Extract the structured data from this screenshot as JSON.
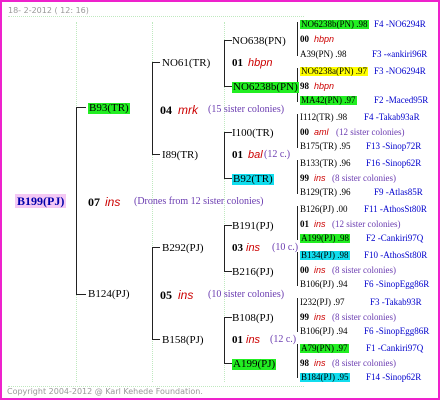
{
  "header": {
    "date": "18-  2-2012 ( 12: 16)"
  },
  "footer": {
    "copyright": "Copyright 2004-2012 @ Karl Kehede Foundation."
  },
  "colors": {
    "frame": "#ee22cc",
    "green": "#22ee22",
    "yellow": "#ffff00",
    "cyan": "#11ddee",
    "root_bg": "#f4c8f4",
    "code_red": "#cc0000",
    "paren_purple": "#6a3bb0",
    "blue_text": "#0000cc"
  },
  "gen1": {
    "name": "B199(PJ)",
    "year": "07",
    "code": "ins",
    "note": "(Drones from 12 sister colonies)"
  },
  "gen2": [
    {
      "name": "B93(TR)",
      "year": "04",
      "code": "mrk",
      "note": "(15 sister colonies)"
    },
    {
      "name": "B124(PJ)",
      "year": "05",
      "code": "ins",
      "note": "(10 sister colonies)"
    }
  ],
  "gen3": [
    {
      "name": "NO61(TR)",
      "year": "01",
      "code": "hbpn"
    },
    {
      "name": "I89(TR)",
      "year": "01",
      "code": "bal",
      "note": "(12 c.)"
    },
    {
      "name": "B292(PJ)",
      "year": "03",
      "code": "ins",
      "note": "(10 c.)"
    },
    {
      "name": "B158(PJ)",
      "year": "01",
      "code": "ins",
      "note": "(12 c.)"
    }
  ],
  "gen4": [
    {
      "name": "NO638(PN)",
      "year": "00",
      "code": "hbpn"
    },
    {
      "name": "NO6238b(PN)",
      "year": "",
      "code": ""
    },
    {
      "name": "I100(TR)",
      "year": "01",
      "code": "bal",
      "note": "(12 c.)"
    },
    {
      "name": "B92(TR)",
      "year": "",
      "code": ""
    },
    {
      "name": "B191(PJ)",
      "year": "",
      "code": ""
    },
    {
      "name": "B216(PJ)",
      "year": "",
      "code": ""
    },
    {
      "name": "B108(PJ)",
      "year": "",
      "code": ""
    },
    {
      "name": "A199(PJ)",
      "year": "",
      "code": ""
    }
  ],
  "gen5": [
    {
      "name": "NO6238b(PN) .98",
      "year": "00",
      "code": "hbpn",
      "tail": "F4 -NO6294R"
    },
    {
      "name": "A39(PN) .98",
      "year": "",
      "code": "",
      "tail": "F3 -«ankiri96R"
    },
    {
      "name": "NO6238a(PN) .97",
      "year": "98",
      "code": "hbpn",
      "tail": "F3 -NO6294R"
    },
    {
      "name": "MA42(PN) .97",
      "year": "",
      "code": "",
      "tail": "F2 -Maced95R"
    },
    {
      "name": "I112(TR) .98",
      "year": "00",
      "code": "aml",
      "note": "(12 sister colonies)",
      "tail": "F4 -Takab93aR"
    },
    {
      "name": "B175(TR) .95",
      "year": "",
      "code": "",
      "tail": "F13 -Sinop72R"
    },
    {
      "name": "B133(TR) .96",
      "year": "99",
      "code": "ins",
      "note": "(8 sister colonies)",
      "tail": "F16 -Sinop62R"
    },
    {
      "name": "B129(TR) .96",
      "year": "",
      "code": "",
      "tail": "F9 -Atlas85R"
    },
    {
      "name": "B126(PJ) .00",
      "year": "01",
      "code": "ins",
      "note": "(12 sister colonies)",
      "tail": "F11 -AthosSt80R"
    },
    {
      "name": "A199(PJ) .98",
      "year": "",
      "code": "",
      "tail": "F2 -Cankiri97Q"
    },
    {
      "name": "B134(PJ) .98",
      "year": "00",
      "code": "ins",
      "note": "(8 sister colonies)",
      "tail": "F10 -AthosSt80R"
    },
    {
      "name": "B106(PJ) .94",
      "year": "",
      "code": "",
      "tail": "F6 -SinopEgg86R"
    },
    {
      "name": "I232(PJ) .97",
      "year": "99",
      "code": "ins",
      "note": "(8 sister colonies)",
      "tail": "F3 -Takab93R"
    },
    {
      "name": "B106(PJ) .94",
      "year": "",
      "code": "",
      "tail": "F6 -SinopEgg86R"
    },
    {
      "name": "A79(PN) .97",
      "year": "98",
      "code": "ins",
      "note": "(8 sister colonies)",
      "tail": "F1 -Cankiri97Q"
    },
    {
      "name": "B184(PJ) .95",
      "year": "",
      "code": "",
      "tail": "F14 -Sinop62R"
    }
  ]
}
